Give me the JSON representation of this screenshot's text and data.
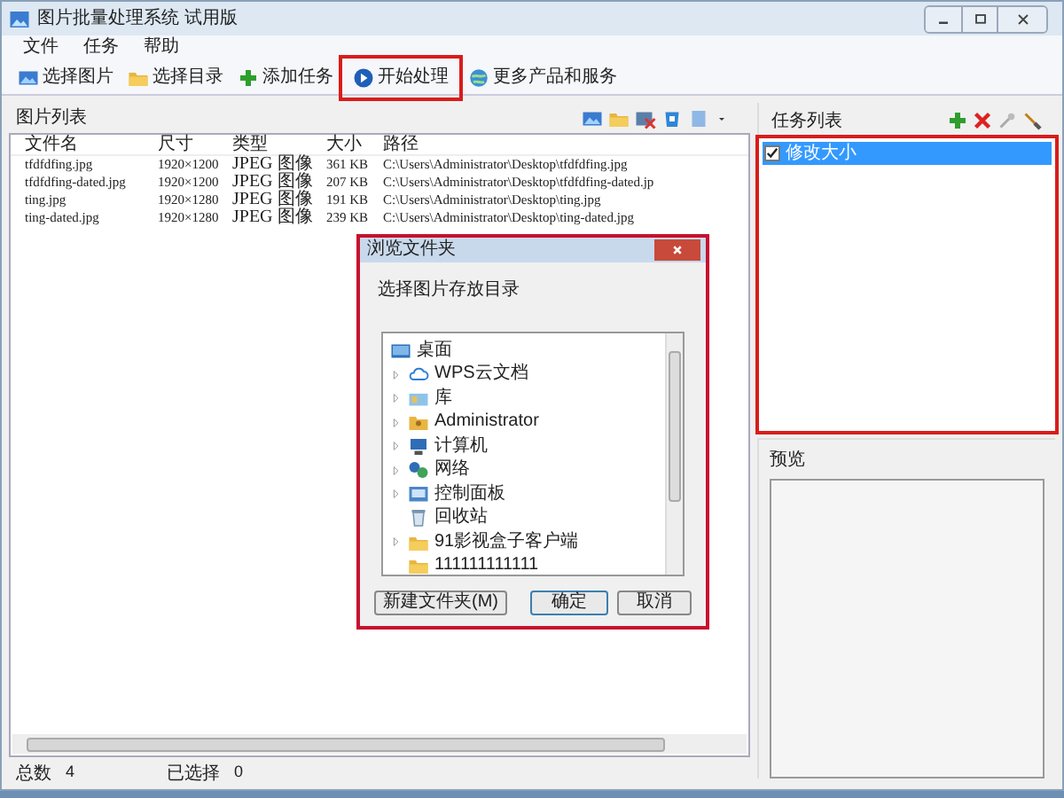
{
  "window": {
    "title": "图片批量处理系统 试用版"
  },
  "menu": [
    "文件",
    "任务",
    "帮助"
  ],
  "toolbar": [
    {
      "label": "选择图片",
      "highlighted": false
    },
    {
      "label": "选择目录",
      "highlighted": false
    },
    {
      "label": "添加任务",
      "highlighted": false
    },
    {
      "label": "开始处理",
      "highlighted": true
    },
    {
      "label": "更多产品和服务",
      "highlighted": false
    }
  ],
  "image_list": {
    "title": "图片列表",
    "columns": [
      "文件名",
      "尺寸",
      "类型",
      "大小",
      "路径"
    ],
    "rows": [
      [
        "tfdfdfing.jpg",
        "1920×1200",
        "JPEG 图像",
        "361 KB",
        "C:\\Users\\Administrator\\Desktop\\tfdfdfing.jpg"
      ],
      [
        "tfdfdfing-dated.jpg",
        "1920×1200",
        "JPEG 图像",
        "207 KB",
        "C:\\Users\\Administrator\\Desktop\\tfdfdfing-dated.jp"
      ],
      [
        "ting.jpg",
        "1920×1280",
        "JPEG 图像",
        "191 KB",
        "C:\\Users\\Administrator\\Desktop\\ting.jpg"
      ],
      [
        "ting-dated.jpg",
        "1920×1280",
        "JPEG 图像",
        "239 KB",
        "C:\\Users\\Administrator\\Desktop\\ting-dated.jpg"
      ]
    ]
  },
  "task_panel": {
    "title": "任务列表",
    "highlighted": true,
    "tasks": [
      {
        "label": "修改大小",
        "checked": true,
        "selected": true
      }
    ]
  },
  "preview": {
    "title": "预览"
  },
  "status_bar": [
    {
      "label": "总数",
      "value": "4"
    },
    {
      "label": "已选择",
      "value": "0"
    }
  ],
  "dialog": {
    "title": "浏览文件夹",
    "highlighted": true,
    "prompt": "选择图片存放目录",
    "tree": [
      {
        "label": "桌面",
        "children": [
          {
            "label": "WPS云文档",
            "has_children": true
          },
          {
            "label": "库",
            "has_children": true
          },
          {
            "label": "Administrator",
            "has_children": true
          },
          {
            "label": "计算机",
            "has_children": true
          },
          {
            "label": "网络",
            "has_children": true
          },
          {
            "label": "控制面板",
            "has_children": true
          },
          {
            "label": "回收站",
            "has_children": false
          },
          {
            "label": "91影视盒子客户端",
            "has_children": true
          },
          {
            "label": "111111111111",
            "has_children": false
          }
        ]
      }
    ],
    "buttons": [
      {
        "label": "新建文件夹(M)",
        "default": false
      },
      {
        "label": "确定",
        "default": true
      },
      {
        "label": "取消",
        "default": false
      }
    ]
  }
}
